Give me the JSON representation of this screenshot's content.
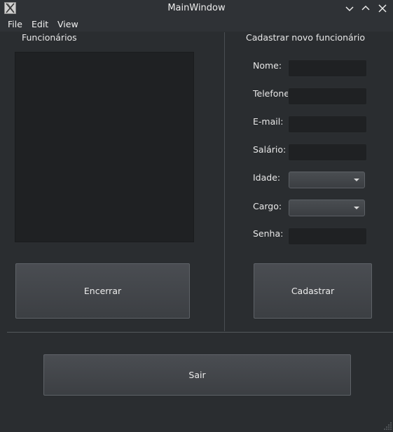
{
  "window": {
    "title": "MainWindow",
    "app_icon": "x-window-icon",
    "controls": [
      "minimize-icon",
      "maximize-icon",
      "close-icon"
    ]
  },
  "menubar": {
    "items": [
      "File",
      "Edit",
      "View"
    ]
  },
  "left_panel": {
    "title": "Funcionários",
    "close_button": "Encerrar"
  },
  "right_panel": {
    "title": "Cadastrar novo funcionário",
    "fields": {
      "nome": {
        "label": "Nome:",
        "value": ""
      },
      "telefone": {
        "label": "Telefone:",
        "value": ""
      },
      "email": {
        "label": "E-mail:",
        "value": ""
      },
      "salario": {
        "label": "Salário:",
        "value": ""
      },
      "idade": {
        "label": "Idade:",
        "selected": ""
      },
      "cargo": {
        "label": "Cargo:",
        "selected": ""
      },
      "senha": {
        "label": "Senha:",
        "value": ""
      }
    },
    "submit_button": "Cadastrar"
  },
  "footer": {
    "exit_button": "Sair"
  }
}
